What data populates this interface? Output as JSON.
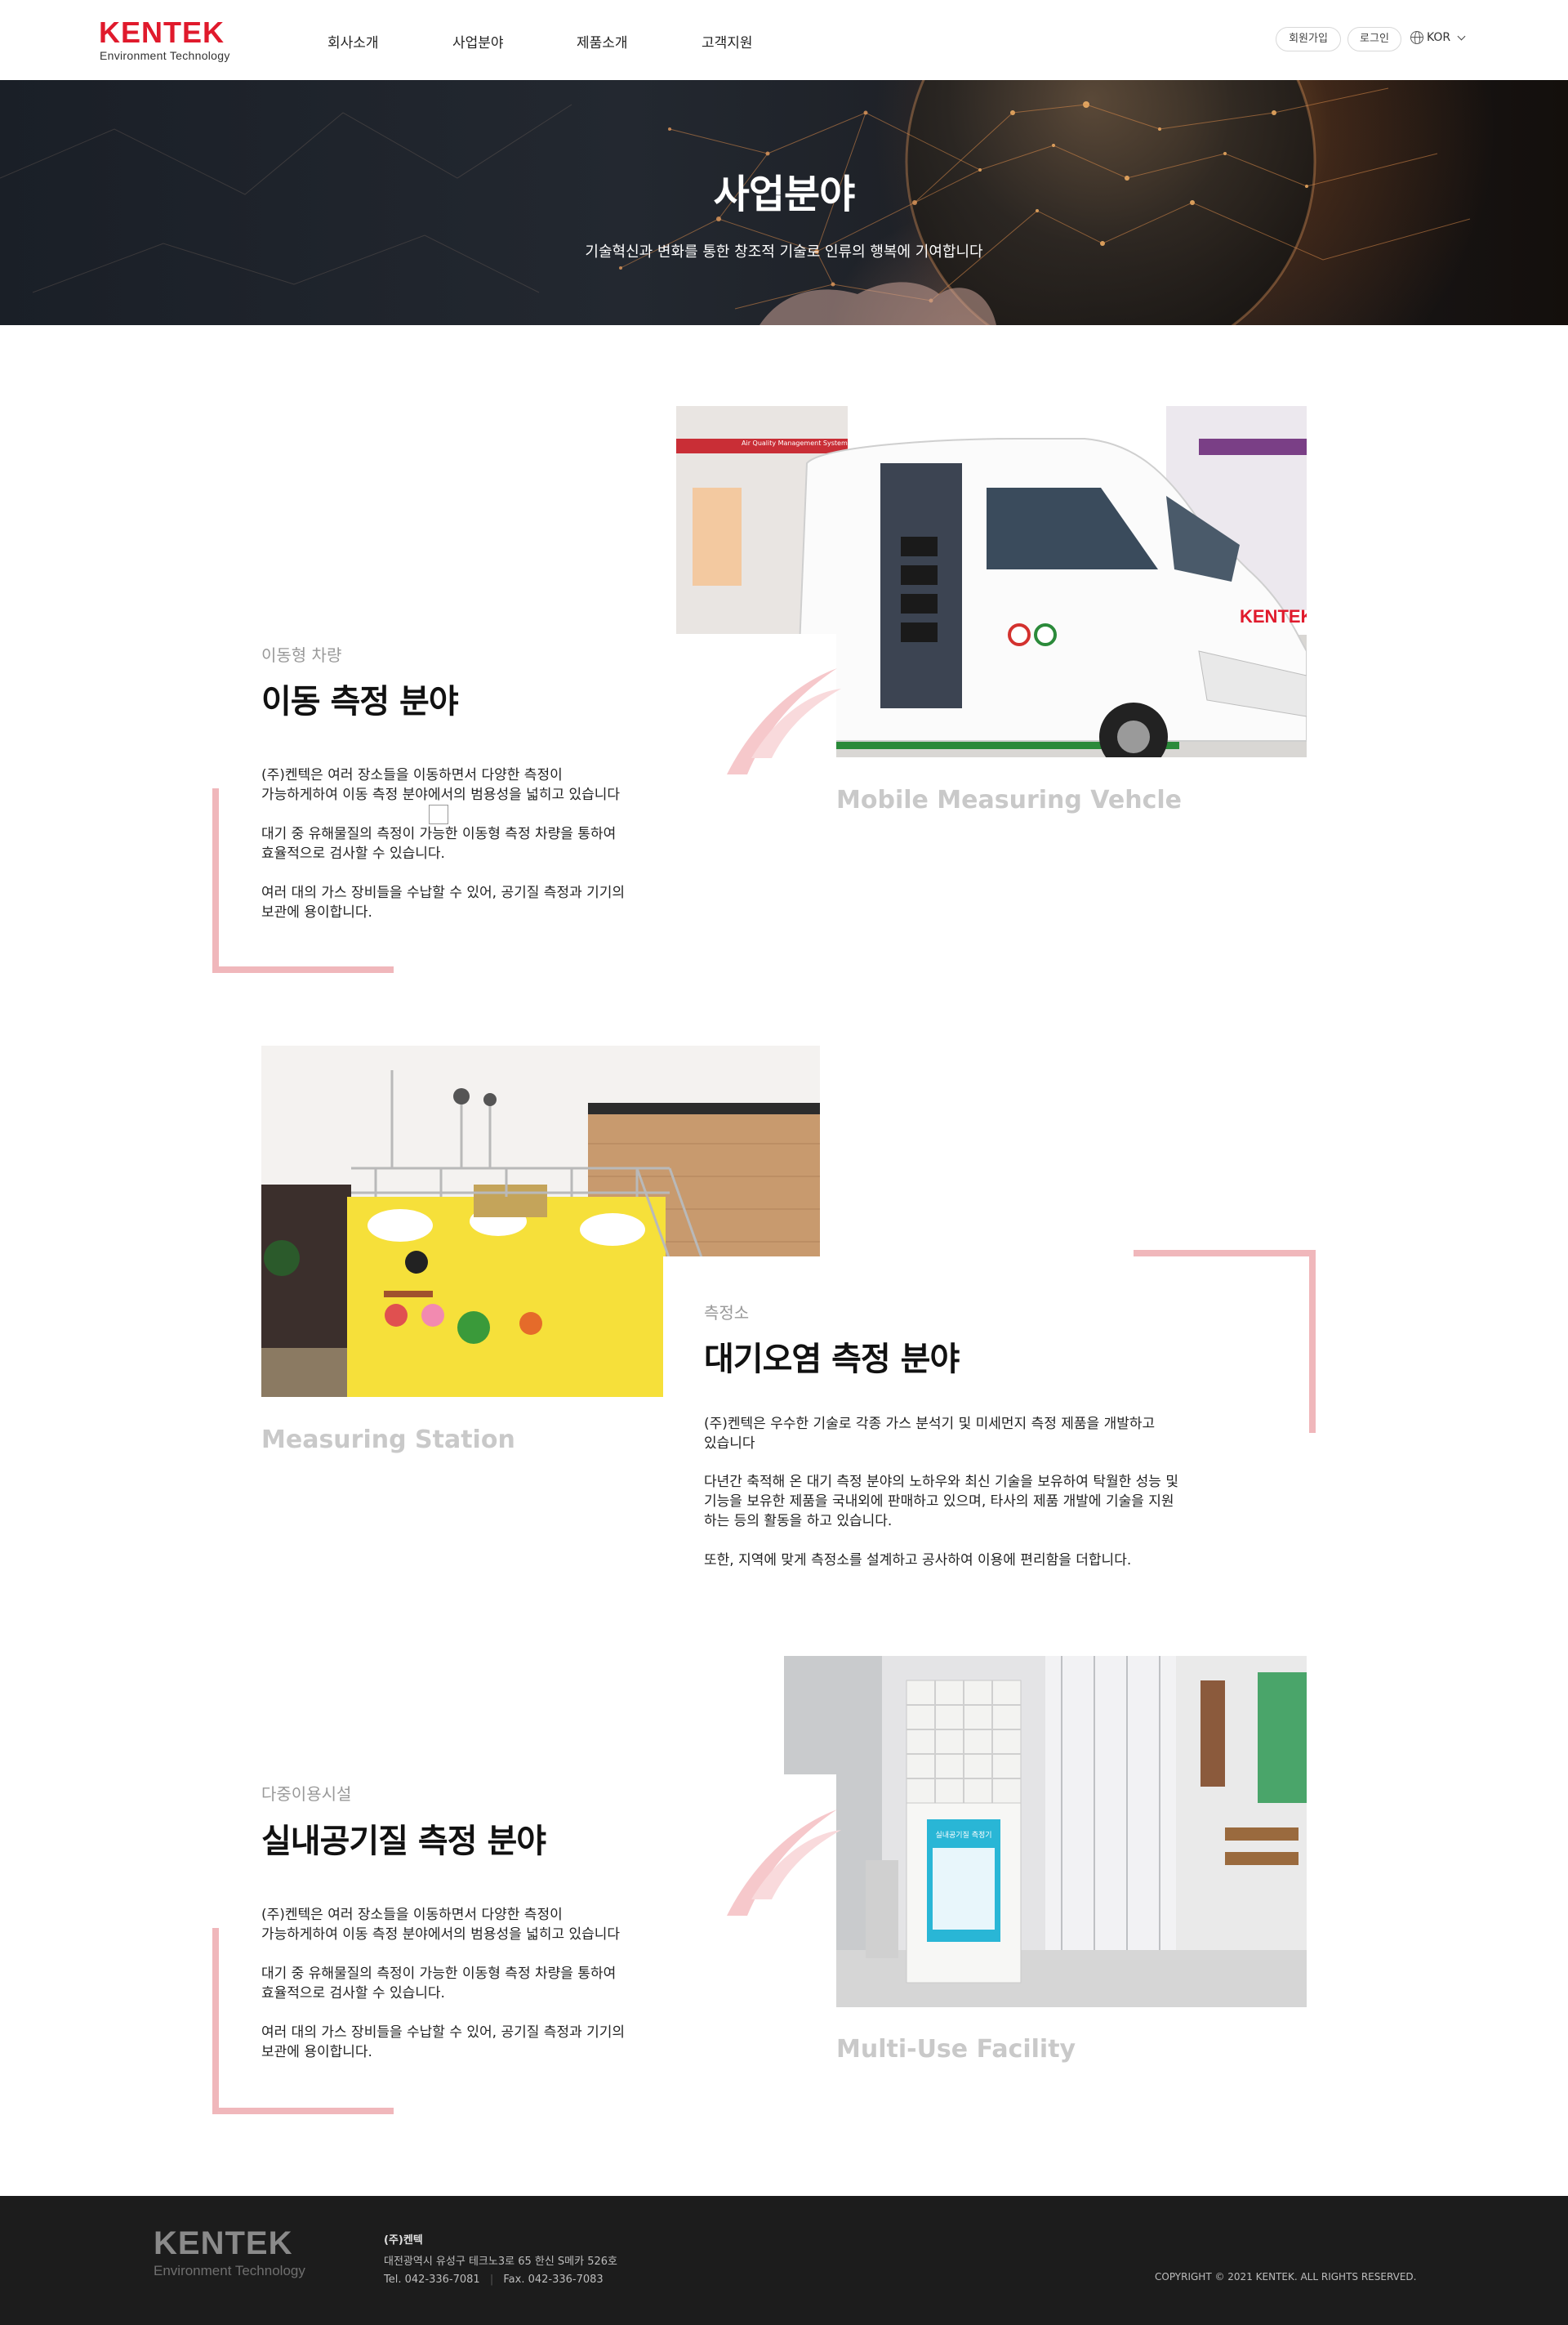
{
  "header": {
    "logo": {
      "word": "KENTEK",
      "sub": "Environment Technology"
    },
    "nav": [
      "회사소개",
      "사업분야",
      "제품소개",
      "고객지원"
    ],
    "util": {
      "signup": "회원가입",
      "login": "로그인",
      "lang": "KOR"
    },
    "icons": {
      "lang": "globe-icon",
      "dropdown": "chevron-down-icon"
    }
  },
  "hero": {
    "title": "사업분야",
    "subtitle": "기술혁신과 변화를 통한 창조적 기술로 인류의 행복에 기여합니다"
  },
  "sections": [
    {
      "category": "이동형 차량",
      "title": "이동 측정 분야",
      "paragraphs": [
        "(주)켄텍은 여러 장소들을 이동하면서 다양한 측정이\n가능하게하여 이동 측정 분야에서의 범용성을 넓히고 있습니다",
        "대기 중 유해물질의 측정이 가능한 이동형 측정 차량을 통하여\n효율적으로 검사할 수 있습니다.",
        "여러 대의 가스 장비들을 수납할 수 있어, 공기질 측정과 기기의\n보관에 용이합니다."
      ],
      "en_label": "Mobile Measuring Vehcle",
      "photo_sign": "Air Quality Management System",
      "photo_brand": "KENTEK"
    },
    {
      "category": "측정소",
      "title": "대기오염 측정 분야",
      "paragraphs": [
        "(주)켄텍은 우수한 기술로 각종 가스 분석기 및 미세먼지 측정 제품을 개발하고\n있습니다",
        "다년간 축적해 온 대기 측정 분야의 노하우와 최신 기술을 보유하여 탁월한 성능 및\n기능을 보유한 제품을 국내외에 판매하고 있으며, 타사의 제품 개발에 기술을 지원\n하는 등의 활동을 하고 있습니다.",
        "또한, 지역에 맞게 측정소를 설계하고 공사하여 이용에 편리함을 더합니다."
      ],
      "en_label": "Measuring Station"
    },
    {
      "category": "다중이용시설",
      "title": "실내공기질 측정 분야",
      "paragraphs": [
        "(주)켄텍은 여러 장소들을 이동하면서 다양한 측정이\n가능하게하여 이동 측정 분야에서의 범용성을 넓히고 있습니다",
        "대기 중 유해물질의 측정이 가능한 이동형 측정 차량을 통하여\n효율적으로 검사할 수 있습니다.",
        "여러 대의 가스 장비들을 수납할 수 있어, 공기질 측정과 기기의\n보관에 용이합니다."
      ],
      "en_label": "Multi-Use Facility",
      "photo_screen": "실내공기질 측정기"
    }
  ],
  "footer": {
    "logo": {
      "word": "KENTEK",
      "sub": "Environment Technology"
    },
    "company": "(주)켄텍",
    "address": "대전광역시 유성구 테크노3로 65 한신 S메카 526호",
    "tel": "Tel. 042-336-7081",
    "fax": "Fax. 042-336-7083",
    "copyright": "COPYRIGHT © 2021 KENTEK. ALL RIGHTS RESERVED."
  },
  "colors": {
    "brand_red": "#e01a2c",
    "accent_pink": "#f0b7bb",
    "muted_label": "#c9c9c9",
    "footer_bg": "#1c1c1c"
  }
}
